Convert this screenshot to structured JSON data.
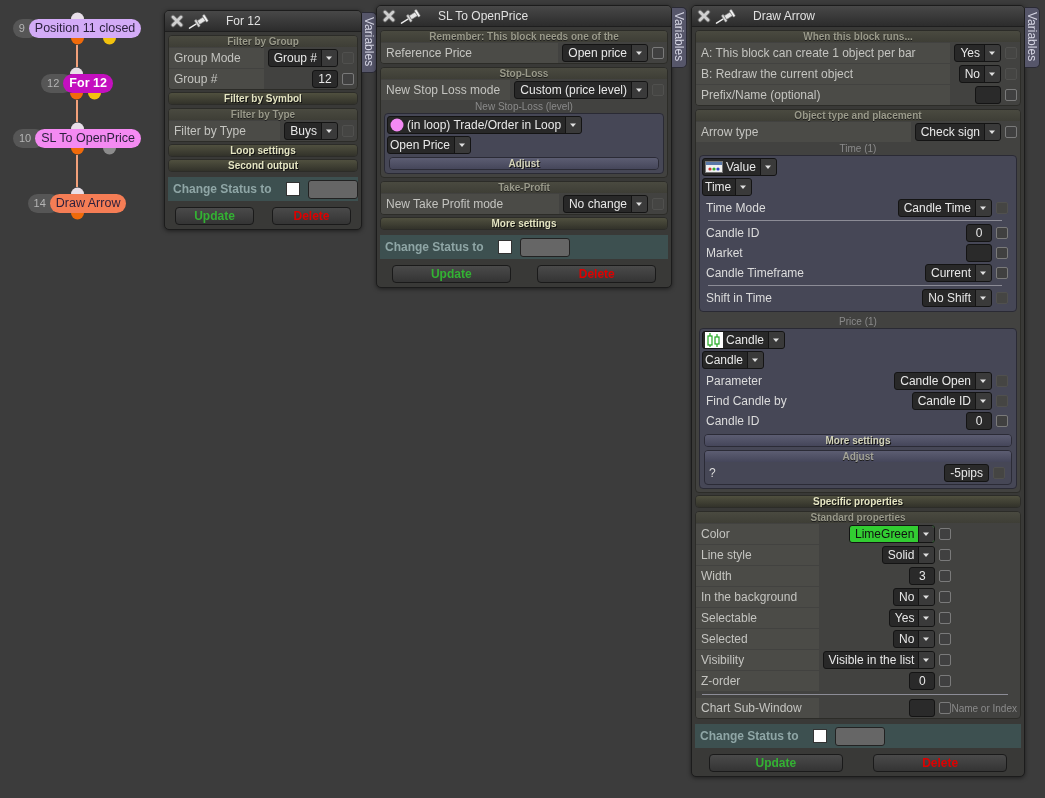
{
  "graph": {
    "nodes": [
      {
        "number": "9",
        "label": "Position 11 closed",
        "color": "#d3abf7",
        "selected": false,
        "outputs": [
          {
            "color": "#f06a0a"
          },
          {
            "color": "#f2c20e"
          }
        ]
      },
      {
        "number": "12",
        "label": "For 12",
        "color": "#c40fbf",
        "selected": true,
        "outputs": [
          {
            "color": "#f06a0a"
          },
          {
            "color": "#f2c20e"
          }
        ]
      },
      {
        "number": "10",
        "label": "SL To OpenPrice",
        "color": "#f48af2",
        "selected": false,
        "outputs": [
          {
            "color": "#f06a0a"
          },
          {
            "color": "#8c8c8c"
          }
        ]
      },
      {
        "number": "14",
        "label": "Draw Arrow",
        "color": "#f57d55",
        "selected": false,
        "outputs": [
          {
            "color": "#f06a0a"
          }
        ]
      }
    ]
  },
  "panels": [
    {
      "title": "For 12",
      "tab": "Variables",
      "sections": [
        {
          "title": "Filter by Group",
          "expanded": true,
          "rows": [
            {
              "kind": "select",
              "label": "Group Mode",
              "value": "Group #",
              "checkbox": {
                "checked": false,
                "disabled": true
              }
            },
            {
              "kind": "input",
              "label": "Group #",
              "value": "12",
              "checkbox": {
                "checked": false,
                "disabled": false
              }
            }
          ]
        },
        {
          "title": "Filter by Symbol",
          "expanded": false
        },
        {
          "title": "Filter by Type",
          "expanded": true,
          "rows": [
            {
              "kind": "select",
              "label": "Filter by Type",
              "value": "Buys",
              "checkbox": {
                "checked": false,
                "disabled": true
              }
            }
          ]
        },
        {
          "title": "Loop settings",
          "expanded": false
        },
        {
          "title": "Second output",
          "expanded": false
        }
      ],
      "status": {
        "label": "Change Status to",
        "checked": false
      },
      "buttons": [
        {
          "kind": "update",
          "label": "Update"
        },
        {
          "kind": "delete",
          "label": "Delete"
        }
      ]
    },
    {
      "title": "SL To OpenPrice",
      "tab": "Variables",
      "sections": [
        {
          "title": "Remember: This block needs one of the",
          "expanded": true,
          "rows": [
            {
              "kind": "select",
              "label": "Reference Price",
              "value": "Open price",
              "checkbox": {
                "checked": false,
                "disabled": false
              }
            }
          ]
        },
        {
          "title": "Stop-Loss",
          "expanded": true,
          "rows": [
            {
              "kind": "select",
              "label": "New Stop Loss mode",
              "value": "Custom (price level)",
              "checkbox": {
                "checked": false,
                "disabled": true
              }
            },
            {
              "kind": "caption",
              "text": "New Stop-Loss (level)"
            },
            {
              "kind": "box",
              "items": [
                {
                  "kind": "loop",
                  "value": "(in loop) Trade/Order in Loop"
                },
                {
                  "kind": "picker",
                  "value": "Open Price"
                },
                {
                  "kind": "section",
                  "title": "Adjust",
                  "expanded": false
                }
              ]
            }
          ]
        },
        {
          "title": "Take-Profit",
          "expanded": true,
          "rows": [
            {
              "kind": "select",
              "label": "New Take Profit mode",
              "value": "No change",
              "checkbox": {
                "checked": false,
                "disabled": true
              }
            }
          ]
        },
        {
          "title": "More settings",
          "expanded": false
        }
      ],
      "status": {
        "label": "Change Status to",
        "checked": false
      },
      "buttons": [
        {
          "kind": "update",
          "label": "Update"
        },
        {
          "kind": "delete",
          "label": "Delete"
        }
      ]
    },
    {
      "title": "Draw Arrow",
      "tab": "Variables",
      "sections": [
        {
          "title": "When this block runs...",
          "expanded": true,
          "rows": [
            {
              "kind": "select",
              "label": "A: This block can create 1 object per bar",
              "value": "Yes",
              "checkbox": {
                "checked": false,
                "disabled": true
              }
            },
            {
              "kind": "select",
              "label": "B: Redraw the current object",
              "value": "No",
              "checkbox": {
                "checked": false,
                "disabled": true
              }
            },
            {
              "kind": "input",
              "label": "Prefix/Name (optional)",
              "checkbox": {
                "checked": false,
                "disabled": false
              }
            }
          ]
        },
        {
          "title": "Object type and placement",
          "expanded": true,
          "rows": [
            {
              "kind": "select",
              "label": "Arrow type",
              "value": "Check sign",
              "checkbox": {
                "checked": false,
                "disabled": false
              }
            },
            {
              "kind": "caption",
              "text": "Time (1)"
            },
            {
              "kind": "box",
              "items": [
                {
                  "kind": "value",
                  "value": "Value"
                },
                {
                  "kind": "picker",
                  "value": "Time"
                },
                {
                  "kind": "select",
                  "label": "Time Mode",
                  "value": "Candle Time",
                  "checkbox": {
                    "checked": false,
                    "disabled": true
                  }
                },
                {
                  "kind": "divider"
                },
                {
                  "kind": "input",
                  "label": "Candle ID",
                  "value": "0",
                  "checkbox": {
                    "checked": false,
                    "disabled": false
                  }
                },
                {
                  "kind": "input",
                  "label": "Market",
                  "checkbox": {
                    "checked": false,
                    "disabled": false
                  }
                },
                {
                  "kind": "select",
                  "label": "Candle Timeframe",
                  "value": "Current",
                  "checkbox": {
                    "checked": false,
                    "disabled": false
                  }
                },
                {
                  "kind": "divider"
                },
                {
                  "kind": "select",
                  "label": "Shift in Time",
                  "value": "No Shift",
                  "checkbox": {
                    "checked": false,
                    "disabled": true
                  }
                }
              ]
            },
            {
              "kind": "caption",
              "text": "Price (1)"
            },
            {
              "kind": "box",
              "items": [
                {
                  "kind": "candle",
                  "value": "Candle"
                },
                {
                  "kind": "picker",
                  "value": "Candle"
                },
                {
                  "kind": "select",
                  "label": "Parameter",
                  "value": "Candle Open",
                  "checkbox": {
                    "checked": false,
                    "disabled": true
                  }
                },
                {
                  "kind": "select",
                  "label": "Find Candle by",
                  "value": "Candle ID",
                  "checkbox": {
                    "checked": false,
                    "disabled": true
                  }
                },
                {
                  "kind": "input",
                  "label": "Candle ID",
                  "value": "0",
                  "checkbox": {
                    "checked": false,
                    "disabled": false
                  }
                },
                {
                  "kind": "section",
                  "title": "More settings",
                  "expanded": false
                },
                {
                  "kind": "section",
                  "title": "Adjust",
                  "expanded": true,
                  "rows": [
                    {
                      "kind": "input",
                      "label": "?",
                      "value": "-5pips",
                      "checkbox": {
                        "checked": false,
                        "disabled": true
                      }
                    }
                  ]
                }
              ]
            }
          ]
        },
        {
          "title": "Specific properties",
          "expanded": false
        },
        {
          "title": "Standard properties",
          "expanded": true,
          "rows": [
            {
              "kind": "select",
              "label": "Color",
              "value": "LimeGreen",
              "color": "#32cd32",
              "checkbox": {
                "checked": false,
                "disabled": false
              }
            },
            {
              "kind": "select",
              "label": "Line style",
              "value": "Solid",
              "checkbox": {
                "checked": false,
                "disabled": false
              }
            },
            {
              "kind": "input",
              "label": "Width",
              "value": "3",
              "checkbox": {
                "checked": false,
                "disabled": false
              }
            },
            {
              "kind": "select",
              "label": "In the background",
              "value": "No",
              "checkbox": {
                "checked": false,
                "disabled": false
              }
            },
            {
              "kind": "select",
              "label": "Selectable",
              "value": "Yes",
              "checkbox": {
                "checked": false,
                "disabled": false
              }
            },
            {
              "kind": "select",
              "label": "Selected",
              "value": "No",
              "checkbox": {
                "checked": false,
                "disabled": false
              }
            },
            {
              "kind": "select",
              "label": "Visibility",
              "value": "Visible in the list",
              "checkbox": {
                "checked": false,
                "disabled": false
              }
            },
            {
              "kind": "input",
              "label": "Z-order",
              "value": "0",
              "checkbox": {
                "checked": false,
                "disabled": false
              }
            },
            {
              "kind": "divider"
            },
            {
              "kind": "input",
              "label": "Chart Sub-Window",
              "hint": "Name or Index",
              "checkbox": {
                "checked": false,
                "disabled": false
              }
            }
          ]
        }
      ],
      "status": {
        "label": "Change Status to",
        "checked": false
      },
      "buttons": [
        {
          "kind": "update",
          "label": "Update"
        },
        {
          "kind": "delete",
          "label": "Delete"
        }
      ]
    }
  ]
}
